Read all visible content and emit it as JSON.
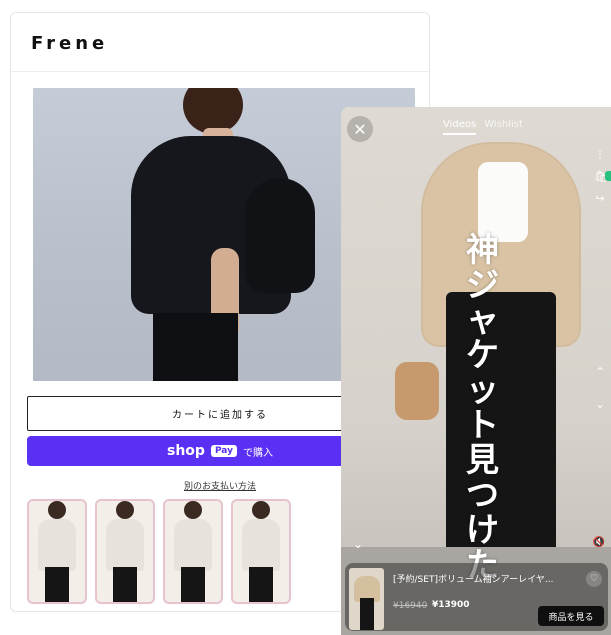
{
  "brand": "Frene",
  "product": {
    "add_to_cart": "カートに追加する",
    "shop_pay": {
      "shop": "shop",
      "pay": "Pay",
      "buy": "で購入"
    },
    "alt_payment": "別のお支払い方法",
    "thumbnails": [
      {
        "label": "thumb-1"
      },
      {
        "label": "thumb-2"
      },
      {
        "label": "thumb-3"
      },
      {
        "label": "thumb-4"
      }
    ]
  },
  "video_overlay": {
    "tabs": [
      "Videos",
      "Wishlist"
    ],
    "caption": "神ジャケット見つけた",
    "card": {
      "title": "[予約/SET]ボリューム袖シアーレイヤ...",
      "old_price": "¥16940",
      "price": "¥13900",
      "button": "商品を見る"
    },
    "icons": {
      "close": "close-icon",
      "bag": "bag-icon",
      "share": "share-icon",
      "more": "more-icon",
      "up": "chevron-up-icon",
      "down": "chevron-down-icon",
      "mute": "mute-icon",
      "heart": "heart-icon"
    },
    "colors": {
      "shop_pay": "#5a31f4",
      "status_dot": "#27c27f"
    }
  }
}
